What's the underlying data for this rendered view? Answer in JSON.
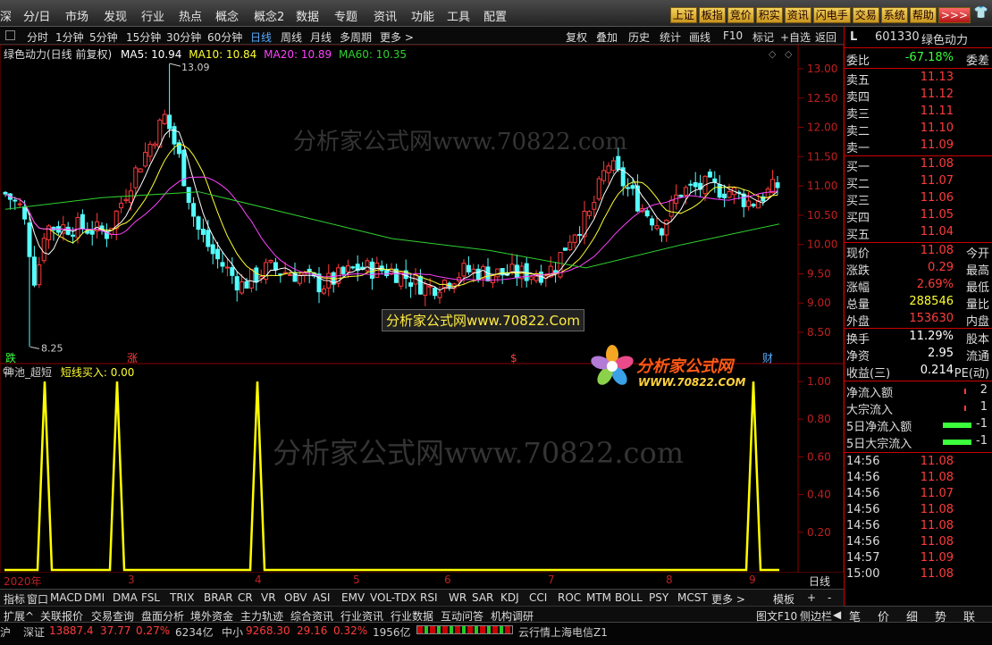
{
  "menu": {
    "items": [
      "深",
      "分/日",
      "市场",
      "发现",
      "行业",
      "热点",
      "概念",
      "概念2",
      "数据",
      "专题",
      "资讯",
      "功能",
      "工具",
      "配置"
    ],
    "quick": [
      "上证",
      "板指",
      "竞价",
      "积实",
      "资讯",
      "闪电手",
      "交易",
      "系统",
      "帮助",
      ">>>"
    ]
  },
  "periods": {
    "items": [
      "分时",
      "1分钟",
      "5分钟",
      "15分钟",
      "30分钟",
      "60分钟",
      "日线",
      "周线",
      "月线",
      "多周期",
      "更多 >"
    ],
    "selected": "日线",
    "right": [
      "复权",
      "叠加",
      "历史",
      "统计",
      "画线",
      "F10",
      "标记",
      "+自选",
      "返回"
    ]
  },
  "legend": {
    "title": "绿色动力(日线 前复权)",
    "ma5": "MA5: 10.94",
    "ma10": "MA10: 10.84",
    "ma20": "MA20: 10.89",
    "ma60": "MA60: 10.35"
  },
  "price_axis": [
    "13.00",
    "12.50",
    "12.00",
    "11.50",
    "11.00",
    "10.50",
    "10.00",
    "9.50",
    "9.00",
    "8.50"
  ],
  "annotations": {
    "high": "13.09",
    "low": "8.25",
    "die": "跌",
    "zhang": "涨",
    "cai": "财",
    "s": "$"
  },
  "ind_legend": {
    "name": "神池_超短",
    "label": "短线买入: 0.00"
  },
  "ind_axis": [
    "1.00",
    "0.80",
    "0.60",
    "0.40",
    "0.20"
  ],
  "dates": [
    "2020年",
    "3",
    "4",
    "5",
    "6",
    "7",
    "8",
    "9"
  ],
  "period_label": "日线",
  "ind_tabs": [
    "指标",
    "窗口",
    "MACD",
    "DMI",
    "DMA",
    "FSL",
    "TRIX",
    "BRAR",
    "CR",
    "VR",
    "OBV",
    "ASI",
    "EMV",
    "VOL-TDX",
    "RSI",
    "WR",
    "SAR",
    "KDJ",
    "CCI",
    "ROC",
    "MTM",
    "BOLL",
    "PSY",
    "MCST",
    "更多 >"
  ],
  "func_tabs": [
    "扩展^",
    "关联报价",
    "交易查询",
    "盘面分析",
    "境外资金",
    "主力轨迹",
    "综合资讯",
    "行业资讯",
    "行业数据",
    "互动问答",
    "机构调研"
  ],
  "func_right": [
    "图文F10",
    "侧边栏",
    "◀"
  ],
  "watermarks": {
    "w1": "分析家公式网www.70822.com",
    "w2": "分析家公式网www.70822.Com",
    "w3": "分析家公式网www.70822.com",
    "logo1": "分析家公式网",
    "logo2": "WWW.70822.COM"
  },
  "quote": {
    "flag": "L",
    "code": "601330",
    "name": "绿色动力",
    "weibi_label": "委比",
    "weibi": "-67.18%",
    "weicha": "委差",
    "asks": [
      {
        "l": "卖五",
        "p": "11.13"
      },
      {
        "l": "卖四",
        "p": "11.12"
      },
      {
        "l": "卖三",
        "p": "11.11"
      },
      {
        "l": "卖二",
        "p": "11.10"
      },
      {
        "l": "卖一",
        "p": "11.09"
      }
    ],
    "bids": [
      {
        "l": "买一",
        "p": "11.08"
      },
      {
        "l": "买二",
        "p": "11.07"
      },
      {
        "l": "买三",
        "p": "11.06"
      },
      {
        "l": "买四",
        "p": "11.05"
      },
      {
        "l": "买五",
        "p": "11.04"
      }
    ],
    "stats": [
      {
        "l": "现价",
        "v": "11.08",
        "r": "今开",
        "c": "red"
      },
      {
        "l": "涨跌",
        "v": "0.29",
        "r": "最高",
        "c": "red"
      },
      {
        "l": "涨幅",
        "v": "2.69%",
        "r": "最低",
        "c": "red"
      },
      {
        "l": "总量",
        "v": "288546",
        "r": "量比",
        "c": "yellow"
      },
      {
        "l": "外盘",
        "v": "153630",
        "r": "内盘",
        "c": "red"
      }
    ],
    "stats2": [
      {
        "l": "换手",
        "v": "11.29%",
        "r": "股本"
      },
      {
        "l": "净资",
        "v": "2.95",
        "r": "流通"
      },
      {
        "l": "收益(三)",
        "v": "0.214",
        "r": "PE(动)"
      }
    ],
    "flows": [
      {
        "l": "净流入额",
        "v": "2"
      },
      {
        "l": "大宗流入",
        "v": "1"
      },
      {
        "l": "5日净流入额",
        "v": "-1"
      },
      {
        "l": "5日大宗流入",
        "v": "-1"
      }
    ],
    "ticks": [
      {
        "t": "14:56",
        "p": "11.08"
      },
      {
        "t": "14:56",
        "p": "11.08"
      },
      {
        "t": "14:56",
        "p": "11.07"
      },
      {
        "t": "14:56",
        "p": "11.08"
      },
      {
        "t": "14:56",
        "p": "11.08"
      },
      {
        "t": "14:56",
        "p": "11.08"
      },
      {
        "t": "14:57",
        "p": "11.09"
      },
      {
        "t": "15:00",
        "p": "11.08"
      }
    ],
    "bottom_tabs": [
      "笔",
      "价",
      "细",
      "势",
      "联"
    ]
  },
  "status": {
    "a": "沪",
    "b": "深证",
    "c": "13887.4",
    "d": "37.77",
    "e": "0.27%",
    "f": "6234亿",
    "g": "中小",
    "h": "9268.30",
    "i": "29.16",
    "j": "0.32%",
    "k": "1956亿",
    "l": "云行情上海电信Z1"
  },
  "colors": {
    "up": "#ff3b3b",
    "down": "#54ffff",
    "ma5": "#ffffff",
    "ma10": "#ffff30",
    "ma20": "#ff40ff",
    "ma60": "#30d030",
    "signal": "#ffff00",
    "grid": "#8b0000"
  },
  "chart_data": {
    "type": "candlestick",
    "title": "绿色动力(日线 前复权)",
    "ylim": [
      8.25,
      13.09
    ],
    "x": [
      "2020-01",
      "2020-02",
      "2020-03",
      "2020-04",
      "2020-05",
      "2020-06",
      "2020-07",
      "2020-08",
      "2020-09"
    ],
    "ma60": [
      10.6,
      10.8,
      10.9,
      10.5,
      10.1,
      9.9,
      9.6,
      10.0,
      10.35
    ],
    "signals": {
      "name": "短线买入",
      "values_at": [
        "2020-02",
        "2020-03",
        "2020-04",
        "2020-09"
      ],
      "value": 1,
      "last": 0
    }
  }
}
